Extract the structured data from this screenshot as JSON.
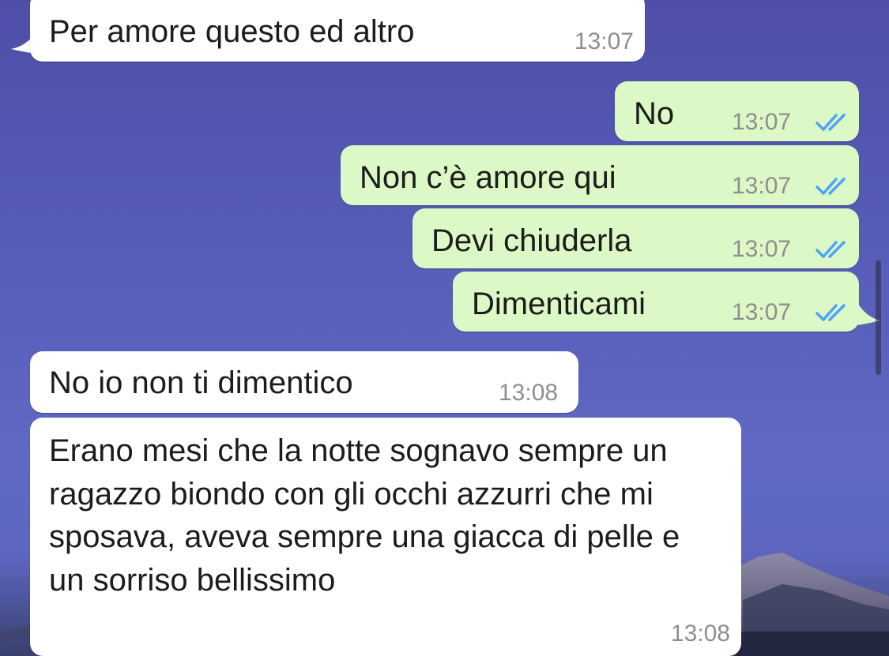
{
  "colors": {
    "incoming_bubble": "#ffffff",
    "outgoing_bubble": "#dcf8c6",
    "read_ticks": "#4fa3f7",
    "timestamp": "#8e8e8e",
    "wallpaper": "#5a61bd"
  },
  "messages": [
    {
      "direction": "incoming",
      "text": "Per amore questo ed altro",
      "time": "13:07"
    },
    {
      "direction": "outgoing",
      "text": "No",
      "time": "13:07",
      "status_icon": "double-check-read-icon"
    },
    {
      "direction": "outgoing",
      "text": "Non c’è amore qui",
      "time": "13:07",
      "status_icon": "double-check-read-icon"
    },
    {
      "direction": "outgoing",
      "text": "Devi chiuderla",
      "time": "13:07",
      "status_icon": "double-check-read-icon"
    },
    {
      "direction": "outgoing",
      "text": "Dimenticami",
      "time": "13:07",
      "status_icon": "double-check-read-icon"
    },
    {
      "direction": "incoming",
      "text": "No io non ti dimentico",
      "time": "13:08"
    },
    {
      "direction": "incoming",
      "text": "Erano mesi che la notte sognavo sempre un ragazzo biondo con gli occhi azzurri che mi sposava, aveva sempre una giacca di pelle e un sorriso bellissimo",
      "time": "13:08"
    }
  ]
}
